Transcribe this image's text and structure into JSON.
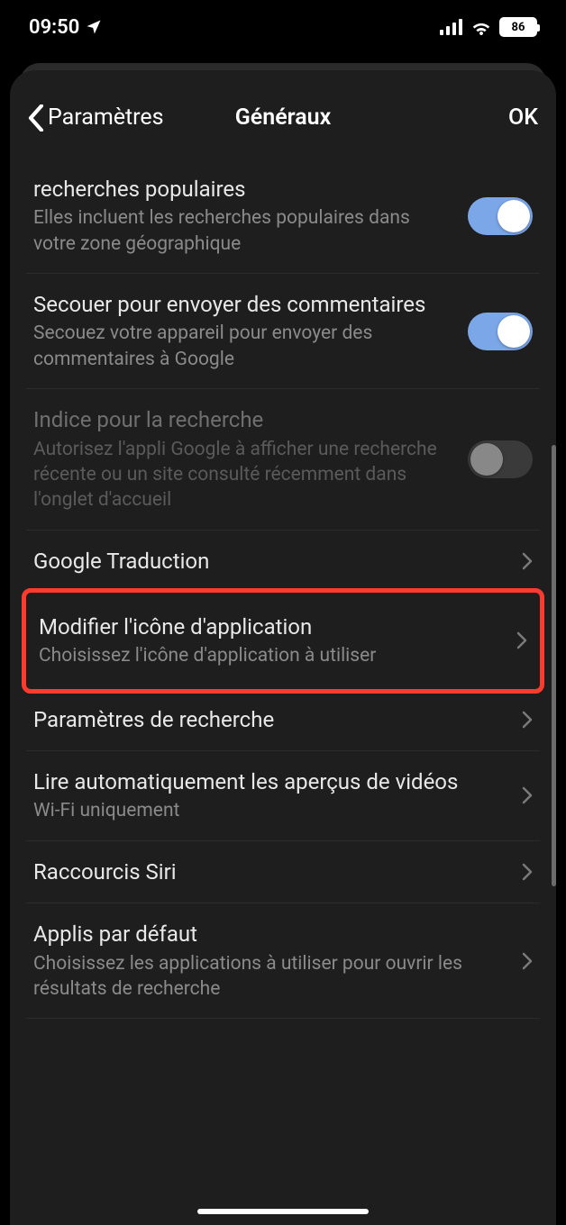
{
  "status": {
    "time": "09:50",
    "battery": "86"
  },
  "nav": {
    "back_label": "Paramètres",
    "title": "Généraux",
    "ok_label": "OK"
  },
  "rows": {
    "popular": {
      "title": "recherches populaires",
      "sub": "Elles incluent les recherches populaires dans votre zone géographique"
    },
    "shake": {
      "title": "Secouer pour envoyer des commentaires",
      "sub": "Secouez votre appareil pour envoyer des commentaires à Google"
    },
    "hint": {
      "title": "Indice pour la recherche",
      "sub": "Autorisez l'appli Google à afficher une recherche récente ou un site consulté récemment dans l'onglet d'accueil"
    },
    "translate": {
      "title": "Google Traduction"
    },
    "icon": {
      "title": "Modifier l'icône d'application",
      "sub": "Choisissez l'icône d'application à utiliser"
    },
    "search_settings": {
      "title": "Paramètres de recherche"
    },
    "autoplay": {
      "title": "Lire automatiquement les aperçus de vidéos",
      "sub": "Wi-Fi uniquement"
    },
    "siri": {
      "title": "Raccourcis Siri"
    },
    "default_apps": {
      "title": "Applis par défaut",
      "sub": "Choisissez les applications à utiliser pour ouvrir les résultats de recherche"
    }
  }
}
